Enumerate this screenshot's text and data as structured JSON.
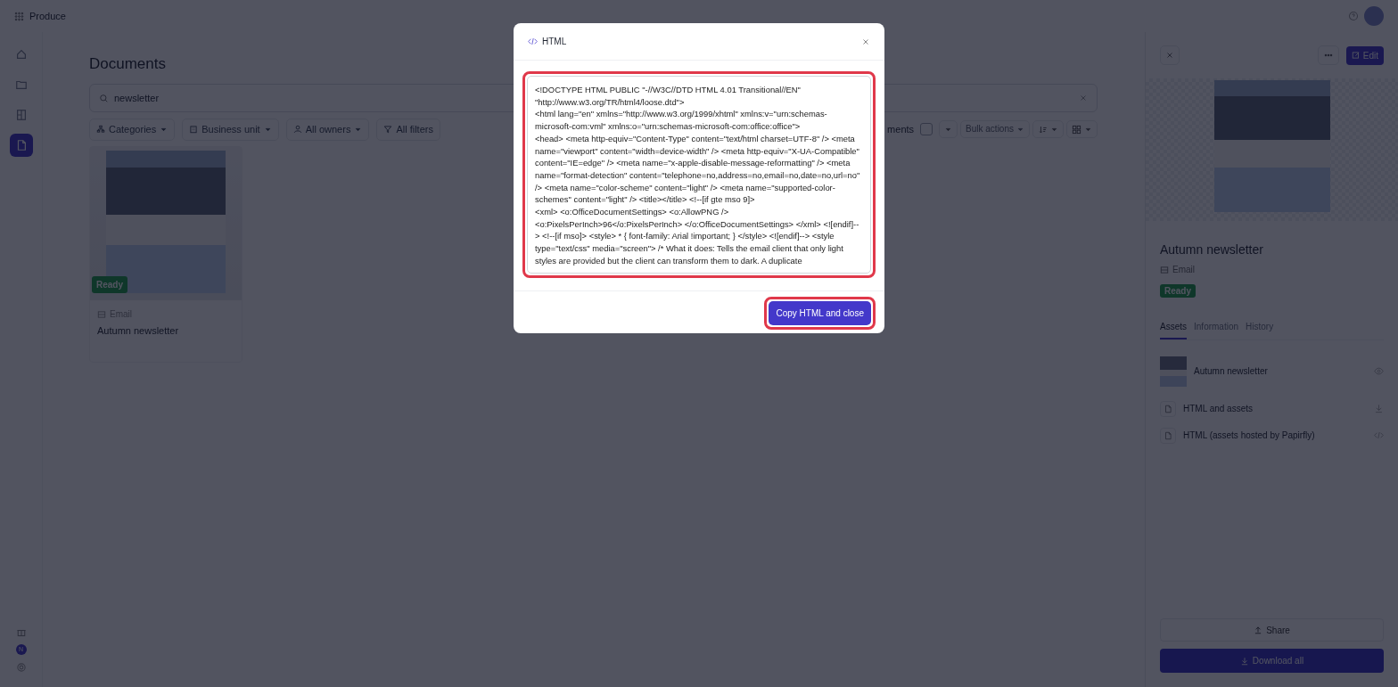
{
  "app": {
    "name": "Produce"
  },
  "sidebar": {
    "items": [
      {
        "selected": false
      },
      {
        "selected": false
      },
      {
        "selected": false
      },
      {
        "selected": true
      }
    ],
    "user_initial": "N"
  },
  "main": {
    "title": "Documents",
    "search": {
      "value": "newsletter"
    },
    "filters": [
      {
        "label": "Categories"
      },
      {
        "label": "Business unit"
      },
      {
        "label": "All owners"
      },
      {
        "label": "All filters"
      }
    ],
    "toolbar": {
      "selection_label": "ments",
      "select_all_checked": false,
      "bulk_actions": "Bulk actions",
      "bulk_actions_disabled": true
    }
  },
  "documents": [
    {
      "type": "Email",
      "name": "Autumn newsletter",
      "status": "Ready"
    }
  ],
  "details": {
    "edit": "Edit",
    "title": "Autumn newsletter",
    "type": "Email",
    "status": "Ready",
    "tabs": [
      {
        "label": "Assets",
        "selected": true
      },
      {
        "label": "Information",
        "selected": false
      },
      {
        "label": "History",
        "selected": false
      }
    ],
    "assets": [
      {
        "kind": "preview",
        "label": "Autumn newsletter"
      },
      {
        "kind": "download",
        "label": "HTML and assets"
      },
      {
        "kind": "code",
        "label": "HTML (assets hosted by Papirfly)"
      }
    ],
    "share": "Share",
    "download_all": "Download all"
  },
  "modal": {
    "title": "HTML",
    "code": "<!DOCTYPE HTML PUBLIC \"-//W3C//DTD HTML 4.01 Transitional//EN\" \"http://www.w3.org/TR/html4/loose.dtd\">\n<html lang=\"en\" xmlns=\"http://www.w3.org/1999/xhtml\" xmlns:v=\"urn:schemas-microsoft-com:vml\" xmlns:o=\"urn:schemas-microsoft-com:office:office\">\n<head> <meta http-equiv=\"Content-Type\" content=\"text/html charset=UTF-8\" /> <meta name=\"viewport\" content=\"width=device-width\" /> <meta http-equiv=\"X-UA-Compatible\" content=\"IE=edge\" /> <meta name=\"x-apple-disable-message-reformatting\" /> <meta name=\"format-detection\" content=\"telephone=no,address=no,email=no,date=no,url=no\" /> <meta name=\"color-scheme\" content=\"light\" /> <meta name=\"supported-color-schemes\" content=\"light\" /> <title></title> <!--[if gte mso 9]>\n<xml> <o:OfficeDocumentSettings> <o:AllowPNG />\n<o:PixelsPerInch>96</o:PixelsPerInch> </o:OfficeDocumentSettings> </xml> <![endif]--> <!--[if mso]> <style> * { font-family: Arial !important; } </style> <![endif]--> <style type=\"text/css\" media=\"screen\"> /* What it does: Tells the email client that only light styles are provided but the client can transform them to dark. A duplicate",
    "button": "Copy HTML and close"
  }
}
